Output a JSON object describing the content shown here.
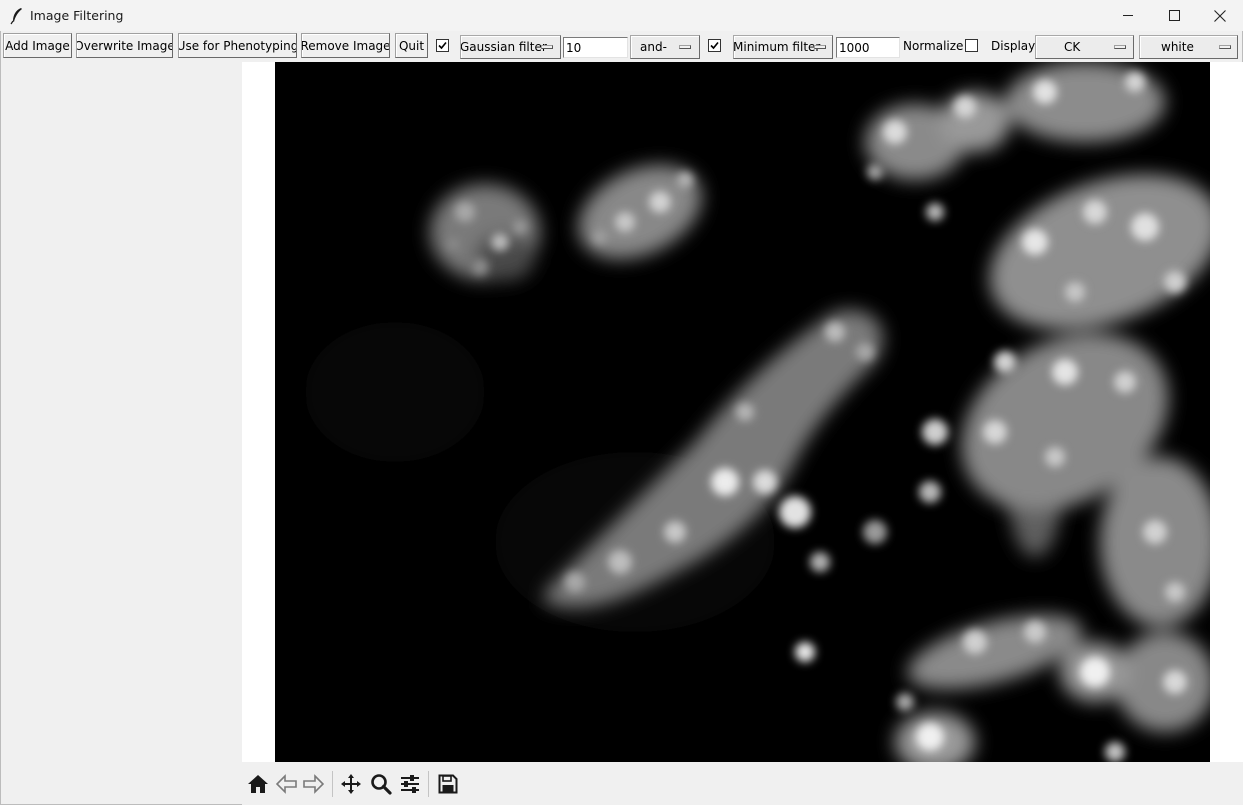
{
  "window": {
    "title": "Image Filtering",
    "controls": [
      "minimize-icon",
      "maximize-icon",
      "close-icon"
    ]
  },
  "toolbar": {
    "add_image": "Add Image",
    "overwrite_image": "Overwrite Image",
    "use_for_phenotyping": "Use for Phenotyping",
    "remove_image": "Remove Image",
    "quit": "Quit",
    "filter1_enabled": true,
    "filter1_type": "Gaussian filter",
    "filter1_value": "10",
    "combine_op": "and-",
    "filter2_enabled": true,
    "filter2_type": "Minimum filter",
    "filter2_value": "1000",
    "normalize_label": "Normalize",
    "normalize_checked": false,
    "display_label": "Display",
    "channel": "CK",
    "color": "white"
  },
  "navigation_toolbar": {
    "icons": [
      "home-icon",
      "back-arrow-icon",
      "forward-arrow-icon",
      "pan-icon",
      "zoom-icon",
      "configure-subplots-icon",
      "save-icon"
    ]
  },
  "colors": {
    "window_bg": "#f0f0f0",
    "image_bg": "#000000",
    "canvas_bg": "#ffffff"
  }
}
